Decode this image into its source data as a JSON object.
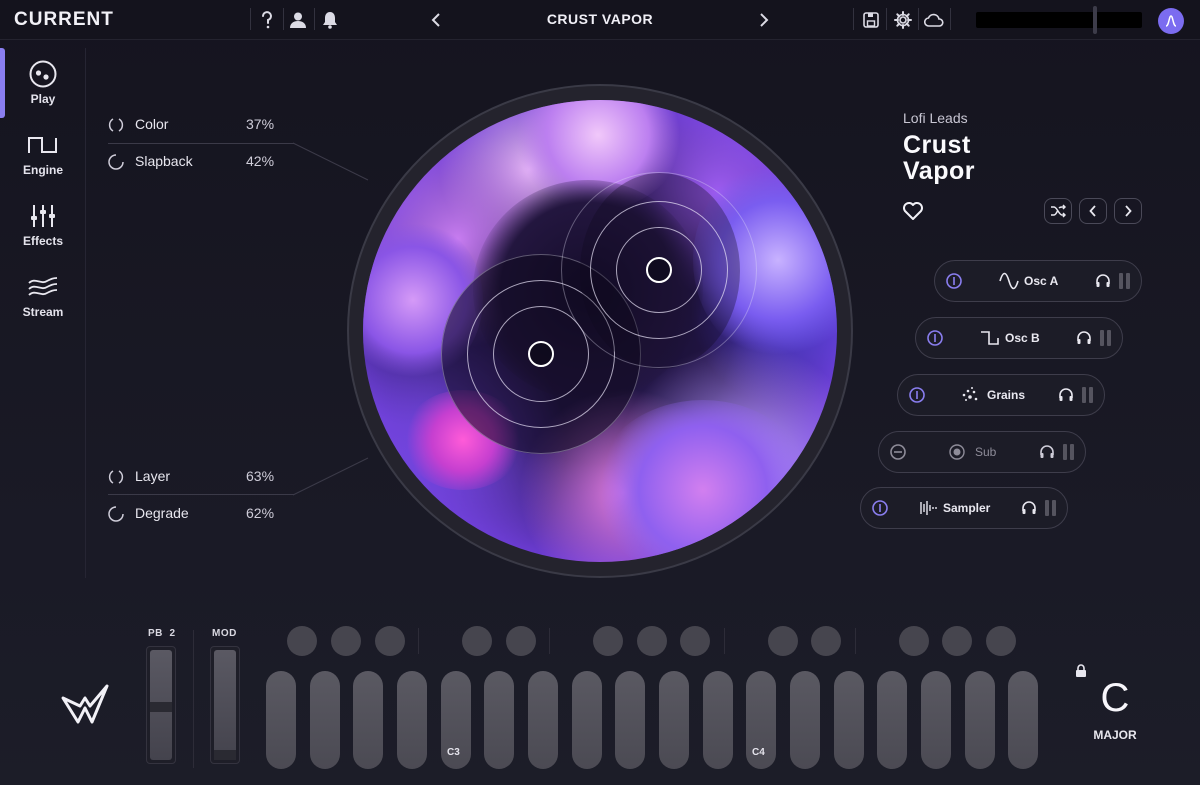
{
  "app": {
    "title": "CURRENT"
  },
  "header": {
    "preset_name": "CRUST VAPOR",
    "icons": [
      "help-icon",
      "user-icon",
      "bell-icon",
      "save-icon",
      "gear-icon",
      "cloud-icon"
    ],
    "master_volume": 0.72
  },
  "sidebar": {
    "items": [
      {
        "label": "Play",
        "icon": "play-knob-icon",
        "active": true
      },
      {
        "label": "Engine",
        "icon": "square-wave-icon",
        "active": false
      },
      {
        "label": "Effects",
        "icon": "sliders-icon",
        "active": false
      },
      {
        "label": "Stream",
        "icon": "waves-icon",
        "active": false
      }
    ]
  },
  "macros": [
    {
      "name": "Color",
      "value": "37%"
    },
    {
      "name": "Slapback",
      "value": "42%"
    },
    {
      "name": "Layer",
      "value": "63%"
    },
    {
      "name": "Degrade",
      "value": "62%"
    }
  ],
  "preset": {
    "category": "Lofi Leads",
    "title_line1": "Crust",
    "title_line2": "Vapor"
  },
  "layers": [
    {
      "name": "Osc A",
      "icon": "sine-wave-icon",
      "enabled": true
    },
    {
      "name": "Osc B",
      "icon": "square-wave-icon",
      "enabled": true
    },
    {
      "name": "Grains",
      "icon": "grains-icon",
      "enabled": true
    },
    {
      "name": "Sub",
      "icon": "sub-icon",
      "enabled": false
    },
    {
      "name": "Sampler",
      "icon": "sampler-icon",
      "enabled": true
    }
  ],
  "keyboard": {
    "pb_label": "PB",
    "pb_range": "2",
    "mod_label": "MOD",
    "note_c3": "C3",
    "note_c4": "C4"
  },
  "scale": {
    "root": "C",
    "mode": "MAJOR"
  },
  "colors": {
    "accent": "#8a7ef0",
    "background": "#1a1a26"
  }
}
